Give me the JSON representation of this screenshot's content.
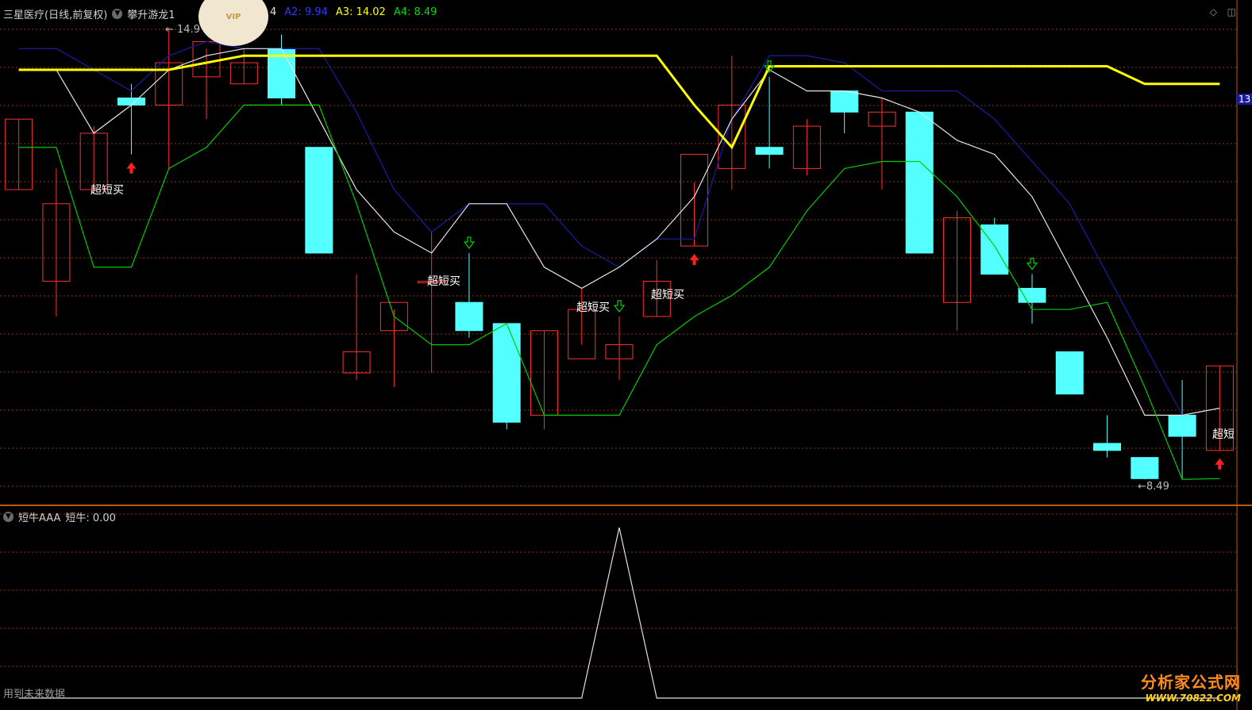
{
  "header": {
    "stock_name": "三星医疗(日线,前复权)",
    "indicator_name": "攀升游龙1",
    "partial_value": "4",
    "a2_text": "A2: 9.94",
    "a3_text": "A3: 14.02",
    "a4_text": "A4: 8.49",
    "colors": {
      "a2": "#2a3cff",
      "a3": "#ffff00",
      "a4": "#00e000"
    }
  },
  "main_chart": {
    "price_high_marker": "← 14.9",
    "price_low_marker": "←8.49",
    "right_axis_partial": "13",
    "signal_label": "超短买",
    "signal_label_cut": "超短",
    "colors": {
      "up": "#ff3030",
      "down": "#54ffff",
      "yellow": "#ffff00",
      "white": "#e6e6e6",
      "blue": "#1a1a9a",
      "green": "#00cc00",
      "grid": "#8a3a00"
    }
  },
  "sub_pane": {
    "indicator": "短牛AAA",
    "value_text": "短牛: 0.00",
    "footer_note": "用到未来数据"
  },
  "watermark": {
    "line1": "分析家公式网",
    "line2": "WWW.70822.COM"
  },
  "vip_badge": "VIP",
  "chart_data": {
    "type": "candlestick",
    "candles": [
      {
        "o": 12.6,
        "h": 13.6,
        "l": 12.6,
        "c": 13.6
      },
      {
        "o": 11.3,
        "h": 12.9,
        "l": 10.8,
        "c": 12.4
      },
      {
        "o": 12.6,
        "h": 13.5,
        "l": 12.6,
        "c": 13.4
      },
      {
        "o": 13.9,
        "h": 14.1,
        "l": 13.1,
        "c": 13.8
      },
      {
        "o": 13.8,
        "h": 14.9,
        "l": 12.9,
        "c": 14.4
      },
      {
        "o": 14.2,
        "h": 14.6,
        "l": 13.6,
        "c": 14.7
      },
      {
        "o": 14.1,
        "h": 14.6,
        "l": 14.1,
        "c": 14.4
      },
      {
        "o": 14.6,
        "h": 14.8,
        "l": 13.8,
        "c": 13.9
      },
      {
        "o": 13.2,
        "h": 13.2,
        "l": 11.7,
        "c": 11.7
      },
      {
        "o": 10.0,
        "h": 11.4,
        "l": 9.9,
        "c": 10.3
      },
      {
        "o": 10.6,
        "h": 10.9,
        "l": 9.8,
        "c": 11.0
      },
      {
        "o": 11.3,
        "h": 12.0,
        "l": 10.0,
        "c": 11.3
      },
      {
        "o": 11.0,
        "h": 11.7,
        "l": 10.5,
        "c": 10.6
      },
      {
        "o": 10.7,
        "h": 10.7,
        "l": 9.2,
        "c": 9.3
      },
      {
        "o": 9.4,
        "h": 10.6,
        "l": 9.2,
        "c": 10.6
      },
      {
        "o": 10.2,
        "h": 11.2,
        "l": 10.4,
        "c": 10.9
      },
      {
        "o": 10.2,
        "h": 10.8,
        "l": 9.9,
        "c": 10.4
      },
      {
        "o": 10.8,
        "h": 11.6,
        "l": 10.8,
        "c": 11.3
      },
      {
        "o": 11.8,
        "h": 12.7,
        "l": 11.8,
        "c": 13.1
      },
      {
        "o": 12.9,
        "h": 14.5,
        "l": 12.6,
        "c": 13.8
      },
      {
        "o": 13.2,
        "h": 14.2,
        "l": 12.9,
        "c": 13.1
      },
      {
        "o": 12.9,
        "h": 13.6,
        "l": 12.8,
        "c": 13.5
      },
      {
        "o": 14.0,
        "h": 14.0,
        "l": 13.4,
        "c": 13.7
      },
      {
        "o": 13.5,
        "h": 13.9,
        "l": 12.6,
        "c": 13.7
      },
      {
        "o": 13.7,
        "h": 13.7,
        "l": 11.7,
        "c": 11.7
      },
      {
        "o": 11.0,
        "h": 12.3,
        "l": 10.6,
        "c": 12.2
      },
      {
        "o": 12.1,
        "h": 12.2,
        "l": 11.4,
        "c": 11.4
      },
      {
        "o": 11.2,
        "h": 11.4,
        "l": 10.7,
        "c": 11.0
      },
      {
        "o": 10.3,
        "h": 10.3,
        "l": 9.7,
        "c": 9.7
      },
      {
        "o": 9.0,
        "h": 9.4,
        "l": 8.8,
        "c": 8.9
      },
      {
        "o": 8.8,
        "h": 8.8,
        "l": 8.49,
        "c": 8.5
      },
      {
        "o": 9.4,
        "h": 9.9,
        "l": 8.5,
        "c": 9.1
      },
      {
        "o": 8.9,
        "h": 10.1,
        "l": 8.9,
        "c": 10.1
      }
    ],
    "yellow_line": [
      14.3,
      14.3,
      14.3,
      14.3,
      14.3,
      14.4,
      14.5,
      14.5,
      14.5,
      14.5,
      14.5,
      14.5,
      14.5,
      14.5,
      14.5,
      14.5,
      14.5,
      14.5,
      13.8,
      13.2,
      14.35,
      14.35,
      14.35,
      14.35,
      14.35,
      14.35,
      14.35,
      14.35,
      14.35,
      14.35,
      14.1,
      14.1,
      14.1
    ],
    "white_line": [
      14.3,
      14.3,
      13.4,
      13.8,
      14.3,
      14.5,
      14.6,
      14.6,
      13.6,
      12.6,
      12.0,
      11.7,
      12.4,
      12.4,
      11.5,
      11.2,
      11.5,
      11.9,
      12.5,
      13.6,
      14.3,
      14.0,
      14.0,
      13.9,
      13.7,
      13.3,
      13.1,
      12.5,
      11.5,
      10.5,
      9.4,
      9.4,
      9.5
    ],
    "blue_line": [
      14.6,
      14.6,
      14.3,
      14.0,
      14.5,
      14.7,
      14.6,
      14.6,
      14.6,
      13.7,
      12.6,
      12.0,
      12.4,
      12.4,
      12.4,
      11.8,
      11.5,
      11.9,
      11.9,
      13.6,
      14.5,
      14.5,
      14.4,
      14.0,
      14.0,
      14.0,
      13.6,
      13.0,
      12.4,
      11.4,
      10.4,
      9.4,
      9.5
    ],
    "green_line": [
      13.2,
      13.2,
      11.5,
      11.5,
      12.9,
      13.2,
      13.8,
      13.8,
      13.8,
      12.4,
      10.8,
      10.4,
      10.4,
      10.7,
      9.4,
      9.4,
      9.4,
      10.4,
      10.8,
      11.1,
      11.5,
      12.3,
      12.9,
      13.0,
      13.0,
      12.5,
      11.8,
      10.9,
      10.9,
      11.0,
      9.8,
      8.49,
      8.5
    ],
    "buy_signals": [
      3,
      18,
      32
    ],
    "sell_signals": [
      12,
      16,
      20,
      27
    ],
    "signal_text_at": [
      2,
      11,
      15,
      17
    ],
    "sub_series": [
      0,
      0,
      0,
      0,
      0,
      0,
      0,
      0,
      0,
      0,
      0,
      0,
      0,
      0,
      0,
      0,
      1,
      0,
      0,
      0,
      0,
      0,
      0,
      0,
      0,
      0,
      0,
      0,
      0,
      0,
      0,
      0,
      0
    ],
    "ylim": [
      8.2,
      15.2
    ]
  }
}
